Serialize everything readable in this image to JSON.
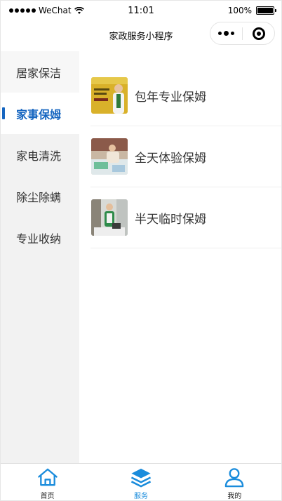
{
  "status_bar": {
    "carrier": "WeChat",
    "time": "11:01",
    "battery": "100%",
    "battery_level": 1.0
  },
  "nav": {
    "title": "家政服务小程序"
  },
  "sidebar": {
    "items": [
      {
        "label": "居家保洁",
        "active": false
      },
      {
        "label": "家事保姆",
        "active": true
      },
      {
        "label": "家电清洗",
        "active": false
      },
      {
        "label": "除尘除螨",
        "active": false
      },
      {
        "label": "专业收纳",
        "active": false
      }
    ]
  },
  "services": [
    {
      "label": "包年专业保姆",
      "thumb": "yellow-poster-image"
    },
    {
      "label": "全天体验保姆",
      "thumb": "cleaning-room-image"
    },
    {
      "label": "半天临时保姆",
      "thumb": "maid-cleaning-image"
    }
  ],
  "tab_bar": {
    "tabs": [
      {
        "label": "首页",
        "icon": "home-icon",
        "active": false
      },
      {
        "label": "服务",
        "icon": "layers-icon",
        "active": true
      },
      {
        "label": "我的",
        "icon": "user-icon",
        "active": false
      }
    ]
  },
  "colors": {
    "accent": "#1565c0",
    "tab_active": "#1a8cdc",
    "sidebar_bg": "#f2f2f2"
  }
}
